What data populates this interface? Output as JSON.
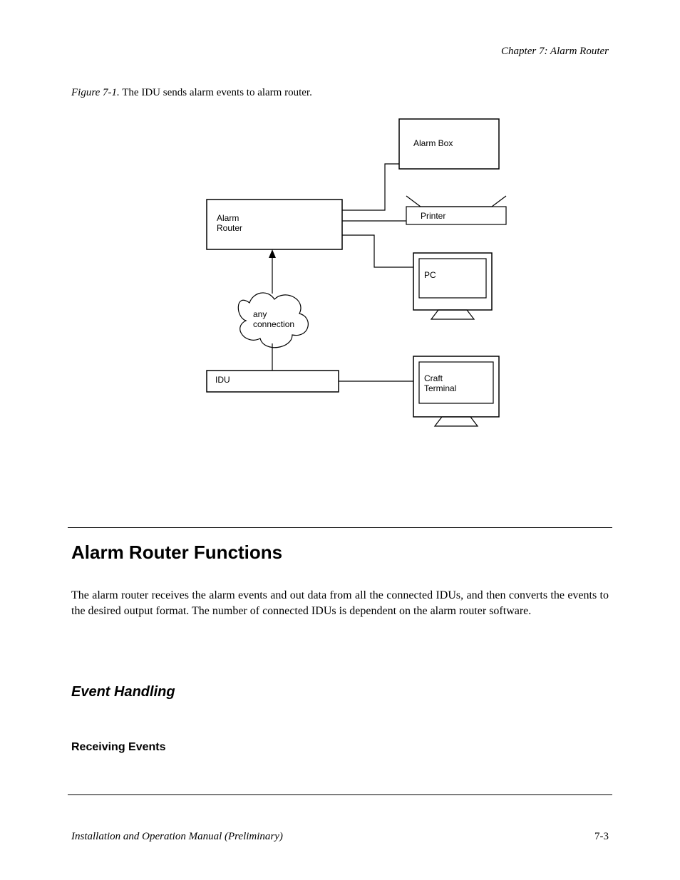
{
  "header": {
    "chapter": "Chapter 7: Alarm Router"
  },
  "figure": {
    "lead": "Figure 7-1.",
    "desc": "The IDU sends alarm events to alarm router.",
    "nodes": {
      "alarm_router": "Alarm\nRouter",
      "alarm_box": "Alarm Box",
      "printer": "Printer",
      "pc": "PC",
      "cloud": "any\nconnection",
      "idu": "IDU",
      "craft_terminal": "Craft\nTerminal"
    }
  },
  "sections": {
    "major": "Alarm Router Functions",
    "body": "The alarm router receives the alarm events and out data from all the connected IDUs, and then converts the events to the desired output format. The number of connected IDUs is dependent on the alarm router software.",
    "sub_italic": "Event Handling",
    "sub3": "Receiving Events"
  },
  "footer": {
    "title": "Installation and Operation Manual (Preliminary)",
    "page": "7-3"
  }
}
